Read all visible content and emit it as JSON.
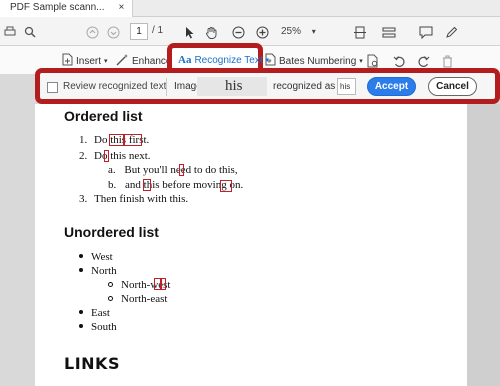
{
  "tab": {
    "title": "PDF Sample scann...",
    "close": "×"
  },
  "toolbar": {
    "page_current": "1",
    "page_total": "/ 1",
    "zoom": "25%",
    "zoom_caret": "▾"
  },
  "subtoolbar": {
    "insert": "Insert",
    "enhance": "Enhance",
    "recognize_text": "Recognize Text",
    "bates_numbering": "Bates Numbering",
    "caret": "▾"
  },
  "recognize_bar": {
    "review_label": "Review recognized text",
    "image_label": "Image",
    "image_word": "his",
    "recognized_as_label": "recognized as",
    "recognized_value": "his",
    "accept": "Accept",
    "cancel": "Cancel"
  },
  "document": {
    "ordered_heading": "Ordered list",
    "ordered": [
      {
        "num": "1.",
        "text": "Do this first."
      },
      {
        "num": "2.",
        "text": "Do this next."
      },
      {
        "num": "3.",
        "text": "Then finish with this."
      }
    ],
    "sub": [
      {
        "num": "a.",
        "text": "But you'll need to do this,"
      },
      {
        "num": "b.",
        "text": "and this before moving on."
      }
    ],
    "unordered_heading": "Unordered list",
    "unordered": [
      "West",
      "North",
      "East",
      "South"
    ],
    "unordered_sub": [
      "North-west",
      "North-east"
    ],
    "links_heading": "LINKS"
  },
  "colors": {
    "accent": "#2b7de9",
    "highlight": "#b31d1d",
    "mark": "#c0202a"
  }
}
